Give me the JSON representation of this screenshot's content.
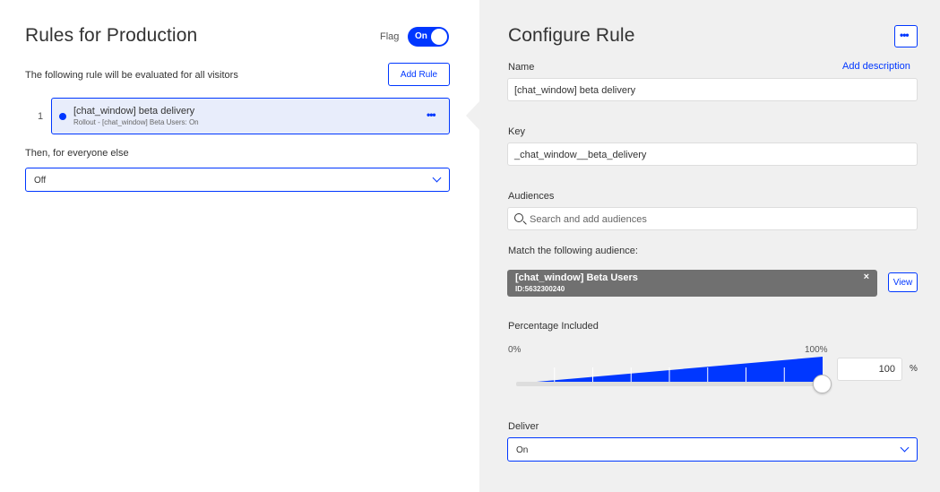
{
  "left": {
    "title": "Rules for Production",
    "flag_label": "Flag",
    "toggle_label": "On",
    "description": "The following rule will be evaluated for all visitors",
    "add_rule_label": "Add Rule",
    "rule": {
      "number": "1",
      "name": "[chat_window] beta delivery",
      "subtitle": "Rollout - [chat_window] Beta Users: On",
      "menu": "•••"
    },
    "else_label": "Then, for everyone else",
    "else_value": "Off"
  },
  "right": {
    "title": "Configure Rule",
    "menu": "•••",
    "name_label": "Name",
    "add_description": "Add description",
    "name_value": "[chat_window] beta delivery",
    "key_label": "Key",
    "key_value": "_chat_window__beta_delivery",
    "audiences_label": "Audiences",
    "audiences_placeholder": "Search and add audiences",
    "match_label": "Match the following audience:",
    "audience": {
      "name": "[chat_window] Beta Users",
      "id": "ID:5632300240",
      "remove": "×"
    },
    "view_label": "View",
    "percentage_label": "Percentage Included",
    "pct_min": "0%",
    "pct_max": "100%",
    "percentage_value": "100",
    "percentage_fraction": 1.0,
    "pct_unit": "%",
    "deliver_label": "Deliver",
    "deliver_value": "On"
  },
  "colors": {
    "accent": "#0037ff",
    "panel_bg": "#f0f0f0",
    "chip_bg": "#707070"
  }
}
